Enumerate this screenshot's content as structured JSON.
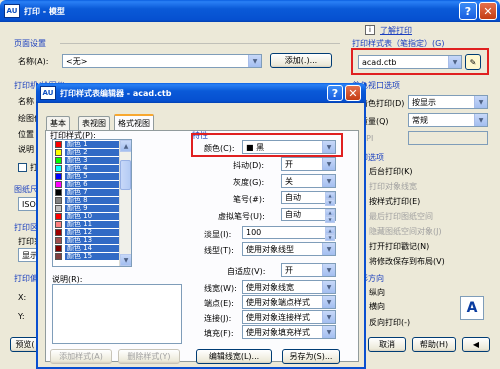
{
  "main_window": {
    "title": "打印 - 模型",
    "app_icon_text": "AU",
    "help_btn": "?",
    "close_btn": "✕",
    "print_link": "了解打印",
    "page_setup": {
      "group": "页面设置",
      "name_label": "名称(A):",
      "name_value": "<无>",
      "add_button": "添加(.)..."
    },
    "print_style_table": {
      "group": "打印样式表（笔指定）(G)",
      "value": "acad.ctb"
    },
    "behind_labels": [
      "打印机/绘图仪",
      "名称",
      "绘图仪",
      "位置",
      "说明",
      "打",
      "图纸尺寸",
      "ISO",
      "打印区",
      "打印范",
      "显示",
      "打印偏",
      "X:",
      "Y:"
    ],
    "viewport_group": "着色视口选项",
    "shade_label": "着色打印(D)",
    "shade_value": "按显示",
    "quality_label": "质量(Q)",
    "quality_value": "常规",
    "dpi_label": "DPI",
    "options_group": "打印选项",
    "options": [
      "后台打印(K)",
      "打印对象线宽",
      "按样式打印(E)",
      "最后打印图纸空间",
      "隐藏图纸空间对象(J)",
      "打开打印戳记(N)",
      "将修改保存到布局(V)"
    ],
    "direction_group": "图形方向",
    "orientation": [
      "纵向",
      "横向",
      "反向打印(-)"
    ],
    "preview_button": "预览(",
    "bottom_buttons": {
      "ok": "确定",
      "cancel": "取消",
      "help": "帮助(H)"
    }
  },
  "editor": {
    "title": "打印样式表编辑器 - acad.ctb",
    "tabs": [
      "基本",
      "表视图",
      "格式视图"
    ],
    "styles_label": "打印样式(P):",
    "styles": [
      {
        "name": "颜色 1",
        "color": "#ff0000"
      },
      {
        "name": "颜色 2",
        "color": "#ffff00"
      },
      {
        "name": "颜色 3",
        "color": "#00ff00"
      },
      {
        "name": "颜色 4",
        "color": "#00ffff"
      },
      {
        "name": "颜色 5",
        "color": "#0000ff"
      },
      {
        "name": "颜色 6",
        "color": "#ff00ff"
      },
      {
        "name": "颜色 7",
        "color": "#000000"
      },
      {
        "name": "颜色 8",
        "color": "#808080"
      },
      {
        "name": "颜色 9",
        "color": "#c0c0c0"
      },
      {
        "name": "颜色 10",
        "color": "#ff0000"
      },
      {
        "name": "颜色 11",
        "color": "#ff8080"
      },
      {
        "name": "颜色 12",
        "color": "#a00000"
      },
      {
        "name": "颜色 13",
        "color": "#a05050"
      },
      {
        "name": "颜色 14",
        "color": "#800000"
      },
      {
        "name": "颜色 15",
        "color": "#804040"
      }
    ],
    "desc_label": "说明(R):",
    "properties_group": "特性",
    "props": {
      "color_label": "颜色(C):",
      "color_value": "■ 黑",
      "dither_label": "抖动(D):",
      "dither_value": "开",
      "gray_label": "灰度(G):",
      "gray_value": "关",
      "pen_label": "笔号(#):",
      "pen_value": "自动",
      "vpen_label": "虚拟笔号(U):",
      "vpen_value": "自动",
      "screen_label": "淡显(I):",
      "screen_value": "100",
      "linetype_label": "线型(T):",
      "linetype_value": "使用对象线型",
      "adaptive_label": "自适应(V):",
      "adaptive_value": "开",
      "lineweight_label": "线宽(W):",
      "lineweight_value": "使用对象线宽",
      "endstyle_label": "端点(E):",
      "endstyle_value": "使用对象端点样式",
      "joinstyle_label": "连接(J):",
      "joinstyle_value": "使用对象连接样式",
      "fillstyle_label": "填充(F):",
      "fillstyle_value": "使用对象填充样式"
    },
    "add_style_button": "添加样式(A)",
    "delete_style_button": "删除样式(Y)",
    "edit_lineweight_button": "编辑线宽(L)...",
    "save_as_button": "另存为(S)..."
  }
}
